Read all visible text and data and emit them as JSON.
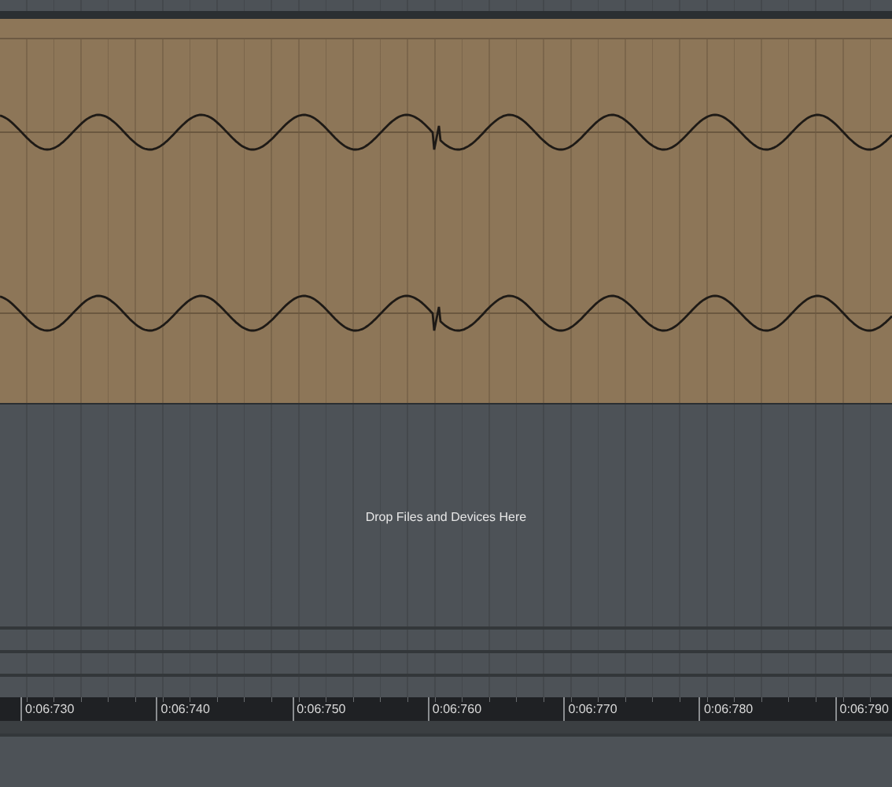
{
  "track": {
    "drop_hint": "Drop Files and Devices Here"
  },
  "ruler": {
    "labels": [
      "0:06:730",
      "0:06:740",
      "0:06:750",
      "0:06:760",
      "0:06:770",
      "0:06:780",
      "0:06:790"
    ]
  }
}
